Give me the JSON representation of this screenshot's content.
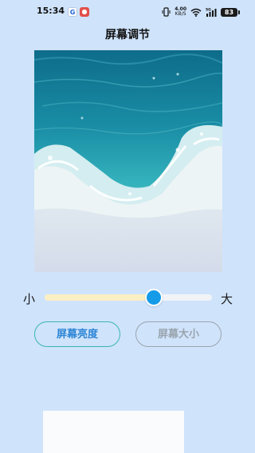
{
  "status_bar": {
    "time": "15:34",
    "net_speed_value": "4.00",
    "net_speed_unit": "KB/S",
    "battery": "83",
    "signal_label": "5G"
  },
  "page": {
    "title": "屏幕调节"
  },
  "preview": {
    "description_icon": "sea-wave-image"
  },
  "slider": {
    "min_label": "小",
    "max_label": "大",
    "value_fraction": 0.65,
    "fill_color": "#fbefc4",
    "thumb_color": "#169be9"
  },
  "buttons": {
    "brightness_label": "屏幕亮度",
    "size_label": "屏幕大小"
  },
  "colors": {
    "background": "#cfe3fb",
    "active_border": "#3bb6b2",
    "active_text": "#2d86d6",
    "inactive": "#9aa4ae"
  }
}
